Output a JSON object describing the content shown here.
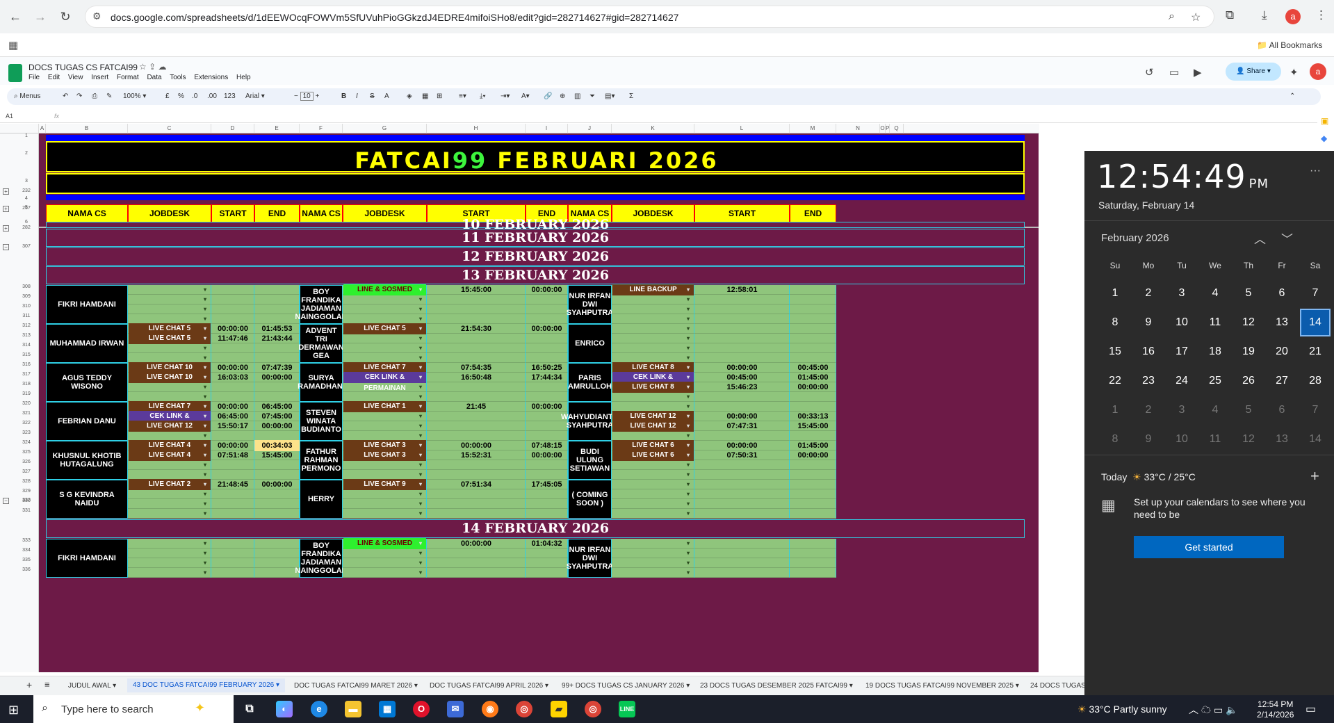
{
  "browser": {
    "url": "docs.google.com/spreadsheets/d/1dEEWOcqFOWVm5SfUVuhPioGGkzdJ4EDRE4mifoiSHo8/edit?gid=282714627#gid=282714627",
    "avatar_letter": "a",
    "all_bookmarks": "All Bookmarks"
  },
  "sheets": {
    "doc_title": "DOCS TUGAS CS FATCAI99",
    "menu": [
      "File",
      "Edit",
      "View",
      "Insert",
      "Format",
      "Data",
      "Tools",
      "Extensions",
      "Help"
    ],
    "share_label": "Share",
    "avatar_letter": "a",
    "toolbar": {
      "menus": "Menus",
      "zoom": "100%",
      "currency": "£",
      "percent": "%",
      "dec_less": ".0",
      "dec_more": ".00",
      "num_fmt": "123",
      "font": "Arial",
      "font_size": "10"
    },
    "cell_ref": "A1",
    "fx": "fx"
  },
  "columns": [
    "A",
    "B",
    "C",
    "D",
    "E",
    "F",
    "G",
    "H",
    "I",
    "J",
    "K",
    "L",
    "M",
    "N",
    "O",
    "P",
    "Q"
  ],
  "rows": [
    "1",
    "2",
    "3",
    "4",
    "5",
    "6",
    "232",
    "257",
    "282",
    "307",
    "308",
    "309",
    "310",
    "311",
    "312",
    "313",
    "314",
    "315",
    "316",
    "317",
    "318",
    "319",
    "320",
    "321",
    "322",
    "323",
    "324",
    "325",
    "326",
    "327",
    "328",
    "329",
    "330",
    "331",
    "332",
    "333",
    "334",
    "335",
    "336"
  ],
  "banner": {
    "title_part1": "FATCAI",
    "title_part2": "99",
    "title_part3": " FEBRUARI 2026"
  },
  "headers": [
    "NAMA CS",
    "JOBDESK",
    "START",
    "END",
    "NAMA CS",
    "JOBDESK",
    "START",
    "END",
    "NAMA CS",
    "JOBDESK",
    "START",
    "END"
  ],
  "dates": [
    "10 FEBRUARY 2026",
    "11 FEBRUARY 2026",
    "12 FEBRUARY 2026",
    "13 FEBRUARY 2026",
    "14 FEBRUARY 2026"
  ],
  "blocks": [
    {
      "names": [
        "FIKRI HAMDANI",
        "BOY FRANDIKA JADIAMAN NAINGGOLAN",
        "NUR IRFAN DWI SYAHPUTRA"
      ],
      "rows": [
        [
          [
            "",
            ""
          ],
          [
            "",
            ""
          ],
          [
            "LINE & SOSMED",
            "green"
          ],
          [
            "15:45:00",
            "00:00:00"
          ],
          [
            "LINE BACKUP",
            "brown"
          ],
          [
            "12:58:01",
            ""
          ]
        ],
        [
          [
            "",
            ""
          ],
          [
            "",
            ""
          ],
          [
            "",
            ""
          ],
          [
            "",
            ""
          ],
          [
            "",
            ""
          ],
          [
            "",
            ""
          ]
        ],
        [
          [
            "",
            ""
          ],
          [
            "",
            ""
          ],
          [
            "",
            ""
          ],
          [
            "",
            ""
          ],
          [
            "",
            ""
          ],
          [
            "",
            ""
          ]
        ],
        [
          [
            "",
            ""
          ],
          [
            "",
            ""
          ],
          [
            "",
            ""
          ],
          [
            "",
            ""
          ],
          [
            "",
            ""
          ],
          [
            "",
            ""
          ]
        ]
      ]
    },
    {
      "names": [
        "MUHAMMAD IRWAN",
        "ADVENT TRI DERMAWAN GEA",
        "ENRICO"
      ],
      "rows": [
        [
          [
            "LIVE CHAT 5",
            "brown"
          ],
          [
            "00:00:00",
            "01:45:53"
          ],
          [
            "LIVE CHAT 5",
            "brown"
          ],
          [
            "21:54:30",
            "00:00:00"
          ],
          [
            "",
            ""
          ],
          [
            "",
            ""
          ]
        ],
        [
          [
            "LIVE CHAT 5",
            "brown"
          ],
          [
            "11:47:46",
            "21:43:44"
          ],
          [
            "",
            ""
          ],
          [
            "",
            ""
          ],
          [
            "",
            ""
          ],
          [
            "",
            ""
          ]
        ],
        [
          [
            "",
            ""
          ],
          [
            "",
            ""
          ],
          [
            "",
            ""
          ],
          [
            "",
            ""
          ],
          [
            "",
            ""
          ],
          [
            "",
            ""
          ]
        ],
        [
          [
            "",
            ""
          ],
          [
            "",
            ""
          ],
          [
            "",
            ""
          ],
          [
            "",
            ""
          ],
          [
            "",
            ""
          ],
          [
            "",
            ""
          ]
        ]
      ]
    },
    {
      "names": [
        "AGUS TEDDY WISONO",
        "SURYA RAMADHANI",
        "PARIS AMRULLOH"
      ],
      "rows": [
        [
          [
            "LIVE CHAT 10",
            "brown"
          ],
          [
            "00:00:00",
            "07:47:39"
          ],
          [
            "LIVE CHAT 7",
            "brown"
          ],
          [
            "07:54:35",
            "16:50:25"
          ],
          [
            "LIVE CHAT 8",
            "brown"
          ],
          [
            "00:00:00",
            "00:45:00"
          ]
        ],
        [
          [
            "LIVE CHAT 10",
            "brown"
          ],
          [
            "16:03:03",
            "00:00:00"
          ],
          [
            "CEK LINK & PERMAINAN",
            "purple"
          ],
          [
            "16:50:48",
            "17:44:34"
          ],
          [
            "CEK LINK & PERMAINAN",
            "purple"
          ],
          [
            "00:45:00",
            "01:45:00"
          ]
        ],
        [
          [
            "",
            ""
          ],
          [
            "",
            ""
          ],
          [
            "",
            ""
          ],
          [
            "",
            ""
          ],
          [
            "LIVE CHAT 8",
            "brown"
          ],
          [
            "15:46:23",
            "00:00:00"
          ]
        ],
        [
          [
            "",
            ""
          ],
          [
            "",
            ""
          ],
          [
            "",
            ""
          ],
          [
            "",
            ""
          ],
          [
            "",
            ""
          ],
          [
            "",
            ""
          ]
        ]
      ]
    },
    {
      "names": [
        "FEBRIAN DANU",
        "STEVEN WINATA BUDIANTO",
        "WAHYUDIANTO SYAHPUTRA"
      ],
      "rows": [
        [
          [
            "LIVE CHAT 7",
            "brown"
          ],
          [
            "00:00:00",
            "06:45:00"
          ],
          [
            "LIVE CHAT 1",
            "brown"
          ],
          [
            "21:45",
            "00:00:00"
          ],
          [
            "",
            ""
          ],
          [
            "",
            ""
          ]
        ],
        [
          [
            "CEK LINK & PERMAINAN",
            "purple"
          ],
          [
            "06:45:00",
            "07:45:00"
          ],
          [
            "",
            ""
          ],
          [
            "",
            ""
          ],
          [
            "LIVE CHAT 12",
            "brown"
          ],
          [
            "00:00:00",
            "00:33:13"
          ]
        ],
        [
          [
            "LIVE CHAT 12",
            "brown"
          ],
          [
            "15:50:17",
            "00:00:00"
          ],
          [
            "",
            ""
          ],
          [
            "",
            ""
          ],
          [
            "LIVE CHAT 12",
            "brown"
          ],
          [
            "07:47:31",
            "15:45:00"
          ]
        ],
        [
          [
            "",
            ""
          ],
          [
            "",
            ""
          ],
          [
            "",
            ""
          ],
          [
            "",
            ""
          ],
          [
            "",
            ""
          ],
          [
            "",
            ""
          ]
        ]
      ]
    },
    {
      "names": [
        "KHUSNUL KHOTIB HUTAGALUNG",
        "FATHUR RAHMAN PERMONO",
        "BUDI ULUNG SETIAWAN"
      ],
      "rows": [
        [
          [
            "LIVE CHAT 4",
            "brown"
          ],
          [
            "00:00:00",
            "00:34:03"
          ],
          [
            "LIVE CHAT 3",
            "brown"
          ],
          [
            "00:00:00",
            "07:48:15"
          ],
          [
            "LIVE CHAT 6",
            "brown"
          ],
          [
            "00:00:00",
            "01:45:00"
          ]
        ],
        [
          [
            "LIVE CHAT 4",
            "brown"
          ],
          [
            "07:51:48",
            "15:45:00"
          ],
          [
            "LIVE CHAT 3",
            "brown"
          ],
          [
            "15:52:31",
            "00:00:00"
          ],
          [
            "LIVE CHAT 6",
            "brown"
          ],
          [
            "07:50:31",
            "00:00:00"
          ]
        ],
        [
          [
            "",
            ""
          ],
          [
            "",
            ""
          ],
          [
            "",
            ""
          ],
          [
            "",
            ""
          ],
          [
            "",
            ""
          ],
          [
            "",
            ""
          ]
        ],
        [
          [
            "",
            ""
          ],
          [
            "",
            ""
          ],
          [
            "",
            ""
          ],
          [
            "",
            ""
          ],
          [
            "",
            ""
          ],
          [
            "",
            ""
          ]
        ]
      ]
    },
    {
      "names": [
        "S G KEVINDRA NAIDU",
        "HERRY",
        "( COMING SOON )"
      ],
      "rows": [
        [
          [
            "LIVE CHAT 2",
            "brown"
          ],
          [
            "21:48:45",
            "00:00:00"
          ],
          [
            "LIVE CHAT 9",
            "brown"
          ],
          [
            "07:51:34",
            "17:45:05"
          ],
          [
            "",
            ""
          ],
          [
            "",
            ""
          ]
        ],
        [
          [
            "",
            ""
          ],
          [
            "",
            ""
          ],
          [
            "",
            ""
          ],
          [
            "",
            ""
          ],
          [
            "",
            ""
          ],
          [
            "",
            ""
          ]
        ],
        [
          [
            "",
            ""
          ],
          [
            "",
            ""
          ],
          [
            "",
            ""
          ],
          [
            "",
            ""
          ],
          [
            "",
            ""
          ],
          [
            "",
            ""
          ]
        ],
        [
          [
            "",
            ""
          ],
          [
            "",
            ""
          ],
          [
            "",
            ""
          ],
          [
            "",
            ""
          ],
          [
            "",
            ""
          ],
          [
            "",
            ""
          ]
        ]
      ]
    }
  ],
  "block14": {
    "names": [
      "FIKRI HAMDANI",
      "BOY FRANDIKA JADIAMAN NAINGGOLAN",
      "NUR IRFAN DWI SYAHPUTRA"
    ],
    "rows": [
      [
        [
          "",
          ""
        ],
        [
          "",
          ""
        ],
        [
          "LINE & SOSMED",
          "green"
        ],
        [
          "00:00:00",
          "01:04:32"
        ],
        [
          "",
          ""
        ],
        [
          "",
          ""
        ]
      ],
      [
        [
          "",
          ""
        ],
        [
          "",
          ""
        ],
        [
          "",
          ""
        ],
        [
          "",
          ""
        ],
        [
          "",
          ""
        ],
        [
          "",
          ""
        ]
      ],
      [
        [
          "",
          ""
        ],
        [
          "",
          ""
        ],
        [
          "",
          ""
        ],
        [
          "",
          ""
        ],
        [
          "",
          ""
        ],
        [
          "",
          ""
        ]
      ],
      [
        [
          "",
          ""
        ],
        [
          "",
          ""
        ],
        [
          "",
          ""
        ],
        [
          "",
          ""
        ],
        [
          "",
          ""
        ],
        [
          "",
          ""
        ]
      ]
    ]
  },
  "tabs": [
    "JUDUL AWAL",
    "DOC TUGAS FATCAI99 FEBRUARY 2026",
    "DOC TUGAS FATCAI99 MARET 2026",
    "DOC TUGAS FATCAI99 APRIL 2026",
    "DOCS TUGAS CS JANUARY 2026",
    "DOCS TUGAS DESEMBER 2025 FATCAI99",
    "DOCS TUGAS FATCAI99 NOVEMBER 2025",
    "DOCS TUGAS"
  ],
  "tab_prefixes": [
    "",
    "43",
    "",
    "",
    "99+",
    "23",
    "19",
    "24"
  ],
  "calendar": {
    "time": "12:54:49",
    "ampm": "PM",
    "date": "Saturday, February 14",
    "month": "February 2026",
    "dow": [
      "Su",
      "Mo",
      "Tu",
      "We",
      "Th",
      "Fr",
      "Sa"
    ],
    "days": [
      [
        "1",
        "2",
        "3",
        "4",
        "5",
        "6",
        "7"
      ],
      [
        "8",
        "9",
        "10",
        "11",
        "12",
        "13",
        "14"
      ],
      [
        "15",
        "16",
        "17",
        "18",
        "19",
        "20",
        "21"
      ],
      [
        "22",
        "23",
        "24",
        "25",
        "26",
        "27",
        "28"
      ],
      [
        "1",
        "2",
        "3",
        "4",
        "5",
        "6",
        "7"
      ],
      [
        "8",
        "9",
        "10",
        "11",
        "12",
        "13",
        "14"
      ]
    ],
    "today_label": "Today",
    "weather": "33°C / 25°C",
    "message": "Set up your calendars to see where you need to be",
    "button": "Get started"
  },
  "taskbar": {
    "search_placeholder": "Type here to search",
    "weather": "33°C  Partly sunny",
    "time": "12:54 PM",
    "date": "2/14/2026"
  }
}
